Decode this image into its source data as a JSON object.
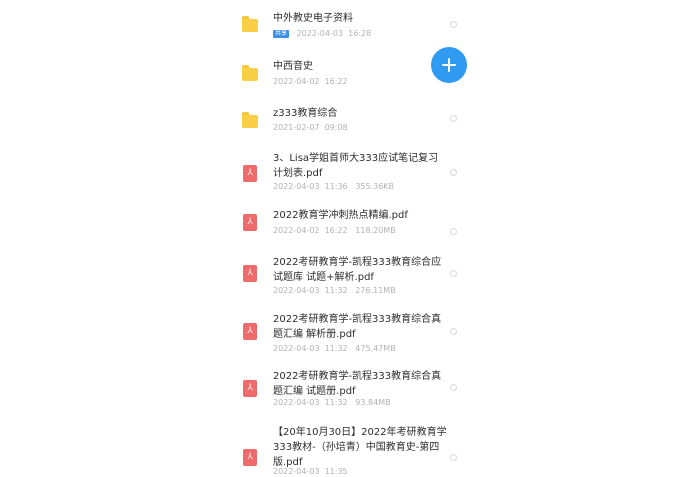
{
  "files": [
    {
      "name": "中外教史电子资料",
      "tag": "共享",
      "date": "2022-04-03",
      "time": "16:28",
      "size": "",
      "type": "folder",
      "icon": "folder-icon"
    },
    {
      "name": "中西音史",
      "tag": "",
      "date": "2022-04-02",
      "time": "16:22",
      "size": "",
      "type": "folder",
      "icon": "folder-icon"
    },
    {
      "name": "z333教育综合",
      "tag": "",
      "date": "2021-02-07",
      "time": "09:08",
      "size": "",
      "type": "folder",
      "icon": "folder-icon"
    },
    {
      "name": "3、Lisa学姐首师大333应试笔记复习计划表.pdf",
      "tag": "",
      "date": "2022-04-03",
      "time": "11:36",
      "size": "355.36KB",
      "type": "pdf",
      "icon": "pdf-icon"
    },
    {
      "name": "2022教育学冲刺热点精编.pdf",
      "tag": "",
      "date": "2022-04-02",
      "time": "16:22",
      "size": "118.20MB",
      "type": "pdf",
      "icon": "pdf-icon"
    },
    {
      "name": "2022考研教育学-凯程333教育综合应试题库 试题+解析.pdf",
      "tag": "",
      "date": "2022-04-03",
      "time": "11:32",
      "size": "276.11MB",
      "type": "pdf",
      "icon": "pdf-icon"
    },
    {
      "name": "2022考研教育学-凯程333教育综合真题汇编 解析册.pdf",
      "tag": "",
      "date": "2022-04-03",
      "time": "11:32",
      "size": "475.47MB",
      "type": "pdf",
      "icon": "pdf-icon"
    },
    {
      "name": "2022考研教育学-凯程333教育综合真题汇编 试题册.pdf",
      "tag": "",
      "date": "2022-04-03",
      "time": "11:32",
      "size": "93.84MB",
      "type": "pdf",
      "icon": "pdf-icon"
    },
    {
      "name": "【20年10月30日】2022年考研教育学333教材-（孙培青）中国教育史-第四版.pdf",
      "tag": "",
      "date": "2022-04-03",
      "time": "11:35",
      "size": "",
      "type": "pdf",
      "icon": "pdf-icon"
    }
  ],
  "fab": {
    "label": "+",
    "icon": "plus-icon",
    "color": "#2f9af2"
  },
  "colors": {
    "folder": "#f9cf46",
    "pdf": "#ef6a6a",
    "tag": "#3a8ee6",
    "meta_text": "#b2b2b2"
  }
}
